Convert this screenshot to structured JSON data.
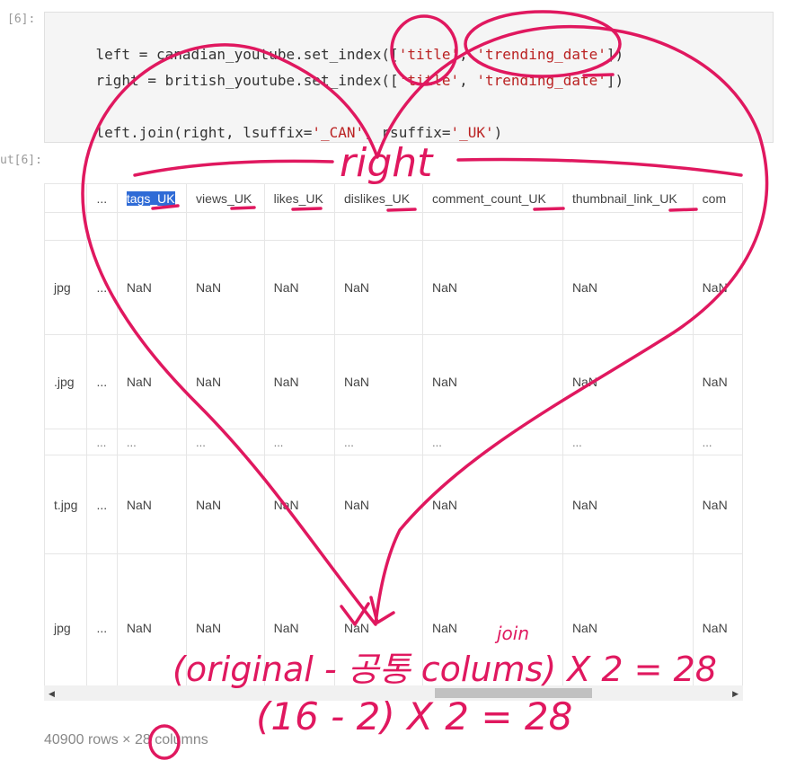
{
  "cell": {
    "in_prompt": "[6]:",
    "out_prompt": "ut[6]:",
    "code": {
      "line1": {
        "a": "left = canadian_youtube.set_index([",
        "s1": "'title'",
        "b": ", ",
        "s2": "'trending_date'",
        "c": "])"
      },
      "line2": {
        "a": "right = british_youtube.set_index([",
        "s1": "'title'",
        "b": ", ",
        "s2": "'trending_date'",
        "c": "])"
      },
      "line3": {
        "a": "left.join(right, lsuffix=",
        "s1": "'_CAN'",
        "b": ", rsuffix=",
        "s2": "'_UK'",
        "c": ")"
      }
    }
  },
  "table": {
    "headers": [
      "",
      "...",
      "tags_UK",
      "views_UK",
      "likes_UK",
      "dislikes_UK",
      "comment_count_UK",
      "thumbnail_link_UK",
      "com"
    ],
    "rows": [
      [
        "jpg",
        "...",
        "NaN",
        "NaN",
        "NaN",
        "NaN",
        "NaN",
        "NaN",
        "NaN"
      ],
      [
        ".jpg",
        "...",
        "NaN",
        "NaN",
        "NaN",
        "NaN",
        "NaN",
        "NaN",
        "NaN"
      ],
      [
        "",
        "...",
        "...",
        "...",
        "...",
        "...",
        "...",
        "...",
        "..."
      ],
      [
        "t.jpg",
        "...",
        "NaN",
        "NaN",
        "NaN",
        "NaN",
        "NaN",
        "NaN",
        "NaN"
      ],
      [
        "jpg",
        "...",
        "NaN",
        "NaN",
        "NaN",
        "NaN",
        "NaN",
        "NaN",
        "NaN"
      ]
    ]
  },
  "footer": {
    "text": "40900 rows × 28 columns"
  },
  "annotations": {
    "right_label": "right",
    "join_label": "join",
    "formula1": "(original - 공통 colums) X 2 = 28",
    "formula2": "(16 - 2) X 2 = 28",
    "color": "#e0185f"
  },
  "colors": {
    "highlight": "#2f6bd6",
    "code_string": "#ba2121"
  }
}
